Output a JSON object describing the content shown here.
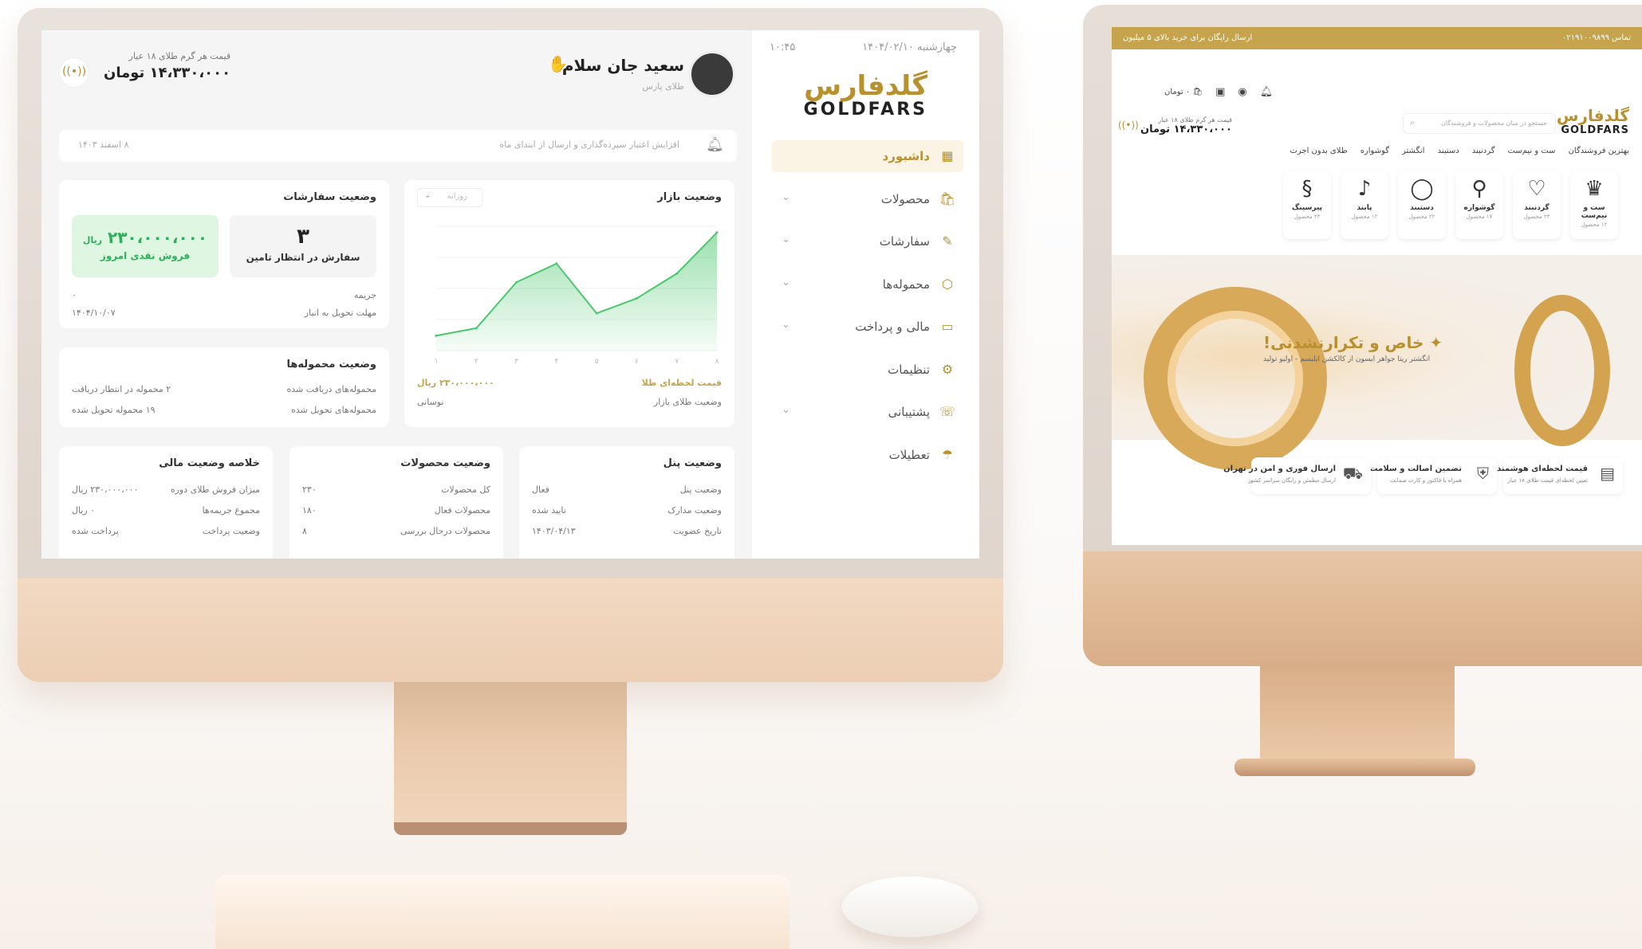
{
  "dashboard": {
    "date": "چهارشنبه ۱۴۰۴/۰۲/۱۰",
    "time": "۱۰:۴۵",
    "logo": {
      "fa": "گلدفارس",
      "en": "GOLDFARS"
    },
    "menu": [
      {
        "label": "داشبورد",
        "icon": "grid-icon",
        "active": true,
        "chevron": false
      },
      {
        "label": "محصولات",
        "icon": "bag-icon",
        "chevron": true
      },
      {
        "label": "سفارشات",
        "icon": "edit-icon",
        "chevron": true
      },
      {
        "label": "محموله‌ها",
        "icon": "box-icon",
        "chevron": true
      },
      {
        "label": "مالی و پرداخت",
        "icon": "wallet-icon",
        "chevron": true
      },
      {
        "label": "تنظیمات",
        "icon": "gear-icon",
        "chevron": false
      },
      {
        "label": "پشتیبانی",
        "icon": "support-icon",
        "chevron": true
      },
      {
        "label": "تعطیلات",
        "icon": "umbrella-icon",
        "chevron": false
      }
    ],
    "header": {
      "greeting": "سعید جان سلام",
      "subtitle": "طلای پارس",
      "price_label": "قیمت هر گرم طلای ۱۸ عیار",
      "price_value": "۱۴،۳۳۰،۰۰۰ تومان"
    },
    "notice": {
      "text": "افزایش اعتبار سپرده‌گذاری و ارسال از ابتدای ماه",
      "date": "۸ اسفند ۱۴۰۳"
    },
    "market": {
      "title": "وضعیت بازار",
      "range": "روزانه",
      "gold_price_label": "قیمت لحظه‌ای طلا",
      "gold_price_value": "۲۳۰،۰۰۰،۰۰۰ ریال",
      "status_label": "وضعیت طلای بازار",
      "status_value": "نوسانی"
    },
    "orders": {
      "title": "وضعیت سفارشات",
      "pending_count": "۳",
      "pending_label": "سفارش در انتظار تامین",
      "cash_value": "۲۳۰،۰۰۰،۰۰۰",
      "cash_unit": "ریال",
      "cash_label": "فروش نقدی امروز",
      "fine_label": "جریمه",
      "fine_value": "۰",
      "deadline_label": "مهلت تحویل به انبار",
      "deadline_value": "۱۴۰۴/۱۰/۰۷"
    },
    "shipments": {
      "title": "وضعیت محموله‌ها",
      "received_label": "محموله‌های دریافت شده",
      "received_value": "۲ محموله در انتظار دریافت",
      "delivered_label": "محموله‌های تحویل شده",
      "delivered_value": "۱۹ محموله تحویل شده"
    },
    "panel": {
      "title": "وضعیت پنل",
      "rows": [
        {
          "k": "وضعیت پنل",
          "v": "فعال"
        },
        {
          "k": "وضعیت مدارک",
          "v": "تایید شده"
        },
        {
          "k": "تاریخ عضویت",
          "v": "۱۴۰۳/۰۴/۱۳"
        }
      ]
    },
    "products": {
      "title": "وضعیت محصولات",
      "rows": [
        {
          "k": "کل محصولات",
          "v": "۲۳۰"
        },
        {
          "k": "محصولات فعال",
          "v": "۱۸۰"
        },
        {
          "k": "محصولات درحال بررسی",
          "v": "۸"
        }
      ]
    },
    "finance": {
      "title": "خلاصه وضعیت مالی",
      "rows": [
        {
          "k": "میزان فروش طلای دوره",
          "v": "۲۳۰،۰۰۰،۰۰۰ ریال"
        },
        {
          "k": "مجموع جریمه‌ها",
          "v": "۰ ریال"
        },
        {
          "k": "وضعیت پرداخت",
          "v": "پرداخت شده"
        }
      ]
    }
  },
  "chart_data": {
    "type": "area",
    "x": [
      "۱",
      "۲",
      "۳",
      "۴",
      "۵",
      "۶",
      "۷",
      "۸"
    ],
    "values": [
      12,
      18,
      55,
      70,
      30,
      42,
      62,
      95
    ],
    "ylim": [
      0,
      100
    ],
    "xlabel": "",
    "ylabel": "",
    "color": "#4cc76e"
  },
  "store": {
    "topbar_right": "تماس ۰۲۱۹۱۰۰۹۸۹۹",
    "topbar_left": "ارسال رایگان برای خرید بالای ۵ میلیون",
    "logo": {
      "fa": "گلدفارس",
      "en": "GOLDFARS"
    },
    "search_placeholder": "جستجو در میان محصولات و فروشندگان",
    "cart_label": "۰ تومان",
    "price_label": "قیمت هر گرم طلای ۱۸ عیار",
    "price_value": "۱۴،۳۳۰،۰۰۰ تومان",
    "nav": [
      "بهترین فروشندگان",
      "ست و نیم‌ست",
      "گردنبند",
      "دستبند",
      "انگشتر",
      "گوشواره",
      "طلای بدون اجرت"
    ],
    "categories": [
      {
        "name": "ست و نیم‌ست",
        "count": "۱۲ محصول",
        "icon": "set-icon",
        "glyph": "♛"
      },
      {
        "name": "گردنبند",
        "count": "۲۳ محصول",
        "icon": "necklace-icon",
        "glyph": "♡"
      },
      {
        "name": "گوشواره",
        "count": "۱۷ محصول",
        "icon": "earring-icon",
        "glyph": "⚲"
      },
      {
        "name": "دستبند",
        "count": "۲۲ محصول",
        "icon": "bracelet-icon",
        "glyph": "◯"
      },
      {
        "name": "پابند",
        "count": "۱۲ محصول",
        "icon": "anklet-icon",
        "glyph": "♪"
      },
      {
        "name": "پیرسینگ",
        "count": "۲۳ محصول",
        "icon": "piercing-icon",
        "glyph": "§"
      }
    ],
    "banner_title": "خاص و تکرارنشدنی!",
    "banner_sub": "انگشتر ریتا جواهر ایسون از کالکشن ایلیسم - اولیو تولید",
    "features": [
      {
        "title": "قیمت لحظه‌ای هوشمند",
        "desc": "تعیین لحظه‌ای قیمت طلای ۱۸ عیار",
        "icon": "chart-icon",
        "glyph": "▤"
      },
      {
        "title": "تضمین اصالت و سلامت طلا",
        "desc": "همراه با فاکتور و کارت ضمانت",
        "icon": "shield-icon",
        "glyph": "⛨"
      },
      {
        "title": "ارسال فوری و امن در تهران",
        "desc": "ارسال مطمئن و رایگان سراسر کشور",
        "icon": "truck-icon",
        "glyph": "⛟"
      }
    ]
  }
}
